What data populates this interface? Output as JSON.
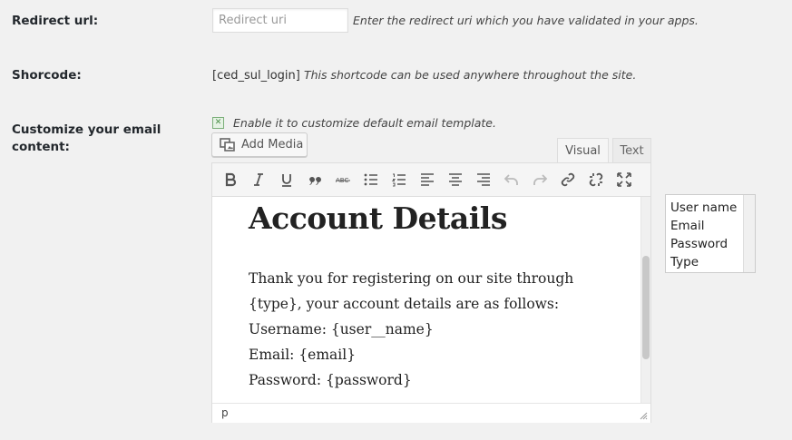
{
  "fields": {
    "redirect": {
      "label": "Redirect url:",
      "placeholder": "Redirect uri",
      "description": "Enter the redirect uri which you have validated in your apps."
    },
    "shortcode": {
      "label": "Shorcode:",
      "code": "[ced_sul_login]",
      "description": "This shortcode can be used anywhere throughout the site."
    },
    "email": {
      "label_line1": "Customize your email",
      "label_line2": "content:",
      "checkbox_label": "Enable it to customize default email template.",
      "checked": true
    }
  },
  "editor": {
    "add_media_label": "Add Media",
    "tabs": {
      "visual": "Visual",
      "text": "Text"
    },
    "active_tab": "visual",
    "toolbar": [
      "bold-icon",
      "italic-icon",
      "underline-icon",
      "blockquote-icon",
      "strikethrough-icon",
      "bullet-list-icon",
      "numbered-list-icon",
      "align-left-icon",
      "align-center-icon",
      "align-right-icon",
      "undo-icon",
      "redo-icon",
      "link-icon",
      "unlink-icon",
      "fullscreen-icon"
    ],
    "content": {
      "heading": "Account Details",
      "lines": [
        "Thank you for registering on our site through",
        "{type}, your account details are as follows:",
        "Username: {user__name}",
        "Email: {email}",
        "Password: {password}"
      ]
    },
    "status_path": "p"
  },
  "variables": [
    "User name",
    "Email",
    "Password",
    "Type"
  ]
}
